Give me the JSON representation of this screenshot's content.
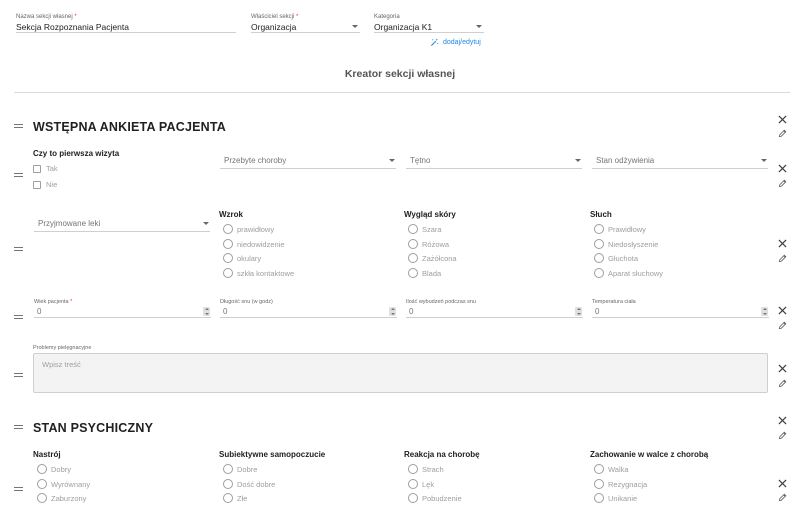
{
  "top": {
    "section_name": {
      "label": "Nazwa sekcji własnej",
      "required": "*",
      "value": "Sekcja Rozpoznania Pacjenta"
    },
    "owner": {
      "label": "Właściciel sekcji",
      "required": "*",
      "value": "Organizacja"
    },
    "category": {
      "label": "Kategoria",
      "value": "Organizacja K1"
    },
    "add_edit_label": "dodaj/edytuj"
  },
  "creator_title": "Kreator sekcji własnej",
  "section1": {
    "title": "WSTĘPNA ANKIETA PACJENTA",
    "row1": {
      "first_visit": {
        "title": "Czy to pierwsza wizyta",
        "options": [
          "Tak",
          "Nie"
        ]
      },
      "selects": [
        "Przebyte choroby",
        "Tętno",
        "Stan odżywienia"
      ]
    },
    "row2": {
      "select": "Przyjmowane leki",
      "groups": [
        {
          "title": "Wzrok",
          "options": [
            "prawidłowy",
            "niedowidzenie",
            "okulary",
            "szkła kontaktowe"
          ]
        },
        {
          "title": "Wygląd skóry",
          "options": [
            "Szara",
            "Różowa",
            "Zażółcona",
            "Blada"
          ]
        },
        {
          "title": "Słuch",
          "options": [
            "Prawidłowy",
            "Niedosłyszenie",
            "Głuchota",
            "Aparat słuchowy"
          ]
        }
      ]
    },
    "row3": {
      "fields": [
        {
          "label": "Wiek pacjenta",
          "required": "*",
          "value": "0"
        },
        {
          "label": "Długość snu (w godz)",
          "required": "",
          "value": "0"
        },
        {
          "label": "Ilość wybudzeń podczas snu",
          "required": "",
          "value": "0"
        },
        {
          "label": "Temperatura ciała",
          "required": "",
          "value": "0"
        }
      ]
    },
    "row4": {
      "label": "Problemy pielęgnacyjne",
      "placeholder": "Wpisz treść"
    }
  },
  "section2": {
    "title": "STAN PSYCHICZNY",
    "groups": [
      {
        "title": "Nastrój",
        "options": [
          "Dobry",
          "Wyrównany",
          "Zaburzony"
        ]
      },
      {
        "title": "Subiektywne samopoczucie",
        "options": [
          "Dobre",
          "Dość dobre",
          "Złe"
        ]
      },
      {
        "title": "Reakcja na chorobę",
        "options": [
          "Strach",
          "Lęk",
          "Pobudzenie"
        ]
      },
      {
        "title": "Zachowanie w walce z chorobą",
        "options": [
          "Walka",
          "Rezygnacja",
          "Unikanie"
        ]
      }
    ]
  },
  "icons": {
    "close": "close-icon",
    "edit": "pencil-icon",
    "drag": "drag-handle-icon",
    "add_edit": "magic-wand-icon"
  },
  "colors": {
    "link": "#1e88e5",
    "required": "#e53935"
  }
}
